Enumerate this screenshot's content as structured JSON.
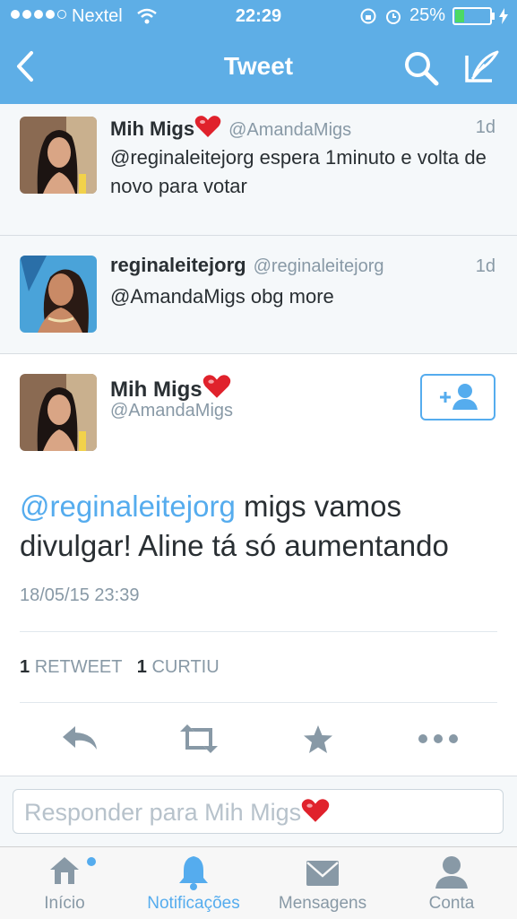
{
  "status_bar": {
    "carrier": "Nextel",
    "time": "22:29",
    "battery": "25%"
  },
  "nav": {
    "title": "Tweet"
  },
  "replies": [
    {
      "name": "Mih Migs",
      "handle": "@AmandaMigs",
      "time": "1d",
      "text": "@reginaleitejorg espera 1minuto e volta de novo para votar"
    },
    {
      "name": "reginaleitejorg",
      "handle": "@reginaleitejorg",
      "time": "1d",
      "text": "@AmandaMigs obg more"
    }
  ],
  "main_tweet": {
    "name": "Mih Migs",
    "handle": "@AmandaMigs",
    "mention": "@reginaleitejorg",
    "text": " migs vamos divulgar! Aline tá só aumentando",
    "date": "18/05/15 23:39",
    "retweet_count": "1",
    "retweet_label": "RETWEET",
    "like_count": "1",
    "like_label": "CURTIU"
  },
  "reply_box": {
    "placeholder": "Responder para Mih Migs"
  },
  "tabs": [
    {
      "label": "Início"
    },
    {
      "label": "Notificações"
    },
    {
      "label": "Mensagens"
    },
    {
      "label": "Conta"
    }
  ],
  "colors": {
    "accent": "#55acee",
    "nav_bg": "#5eaee6",
    "muted": "#8899a6"
  }
}
